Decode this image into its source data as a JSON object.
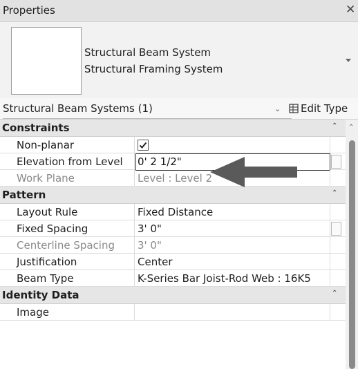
{
  "window": {
    "title": "Properties",
    "close": "✕"
  },
  "type_selector": {
    "family": "Structural Beam System",
    "type": "Structural Framing System"
  },
  "filter": {
    "label": "Structural Beam Systems (1)",
    "edit_type_label": "Edit Type"
  },
  "sections": [
    {
      "name": "Constraints",
      "rows": [
        {
          "name": "Non-planar",
          "value": "",
          "checked": true
        },
        {
          "name": "Elevation from Level",
          "value": "0'  2 1/2\""
        },
        {
          "name": "Work Plane",
          "value": "Level : Level 2"
        }
      ]
    },
    {
      "name": "Pattern",
      "rows": [
        {
          "name": "Layout Rule",
          "value": "Fixed Distance"
        },
        {
          "name": "Fixed Spacing",
          "value": "3'  0\""
        },
        {
          "name": "Centerline Spacing",
          "value": "3'  0\""
        },
        {
          "name": "Justification",
          "value": "Center"
        },
        {
          "name": "Beam Type",
          "value": "K-Series Bar Joist-Rod Web : 16K5"
        }
      ]
    },
    {
      "name": "Identity Data",
      "rows": [
        {
          "name": "Image",
          "value": ""
        }
      ]
    }
  ],
  "colors": {
    "header_bg": "#e2e2e2",
    "section_bg": "#e6e6e6",
    "dim_text": "#8a8a8a",
    "arrow": "#5a5a5a"
  }
}
